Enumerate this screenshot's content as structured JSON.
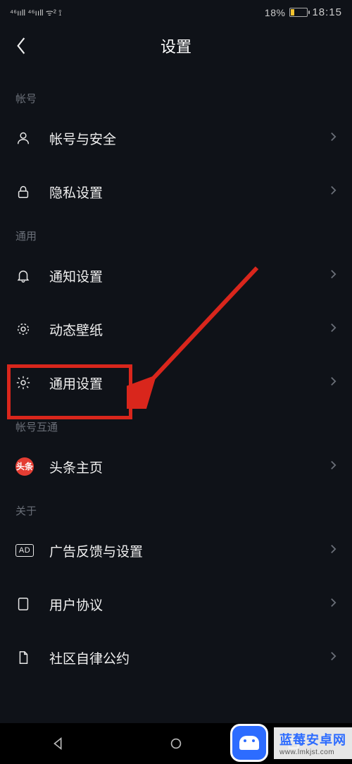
{
  "status": {
    "signal_left_text": "⁴⁶ııll ⁴⁶ııll ᯤ² ⟟",
    "battery_pct": "18%",
    "time": "18:15"
  },
  "header": {
    "title": "设置"
  },
  "sections": [
    {
      "id": "account",
      "header": "帐号",
      "items": [
        {
          "name": "account-security",
          "label": "帐号与安全"
        },
        {
          "name": "privacy",
          "label": "隐私设置"
        }
      ]
    },
    {
      "id": "general",
      "header": "通用",
      "items": [
        {
          "name": "notifications",
          "label": "通知设置"
        },
        {
          "name": "live-wallpaper",
          "label": "动态壁纸"
        },
        {
          "name": "general-settings",
          "label": "通用设置"
        }
      ]
    },
    {
      "id": "linking",
      "header": "帐号互通",
      "items": [
        {
          "name": "toutiao-home",
          "label": "头条主页"
        }
      ]
    },
    {
      "id": "about",
      "header": "关于",
      "items": [
        {
          "name": "ad-settings",
          "label": "广告反馈与设置"
        },
        {
          "name": "user-agreement",
          "label": "用户协议"
        },
        {
          "name": "community-rules",
          "label": "社区自律公约"
        }
      ]
    }
  ],
  "watermark": {
    "title": "蓝莓安卓网",
    "url": "www.lmkjst.com"
  }
}
